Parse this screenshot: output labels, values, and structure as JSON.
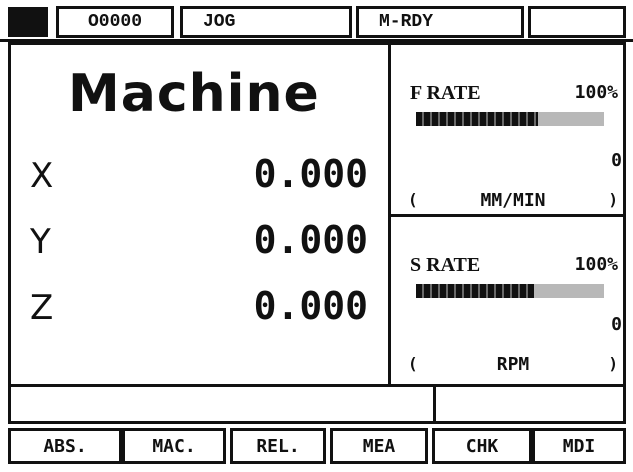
{
  "status": {
    "program": "O0000",
    "mode": "JOG",
    "state": "M-RDY",
    "extra": ""
  },
  "position": {
    "title": "Machine",
    "axes": [
      {
        "label": "X",
        "value": "0.000"
      },
      {
        "label": "Y",
        "value": "0.000"
      },
      {
        "label": "Z",
        "value": "0.000"
      }
    ]
  },
  "feed": {
    "label": "F RATE",
    "percent_text": "100%",
    "bar_level": 0.65,
    "value": "0",
    "paren_open": "(",
    "unit": "MM/MIN",
    "paren_close": ")"
  },
  "spindle": {
    "label": "S RATE",
    "percent_text": "100%",
    "bar_level": 0.63,
    "value": "0",
    "paren_open": "(",
    "unit": "RPM",
    "paren_close": ")"
  },
  "softkeys": [
    "ABS.",
    "MAC.",
    "REL.",
    "MEA",
    "CHK",
    "MDI"
  ]
}
